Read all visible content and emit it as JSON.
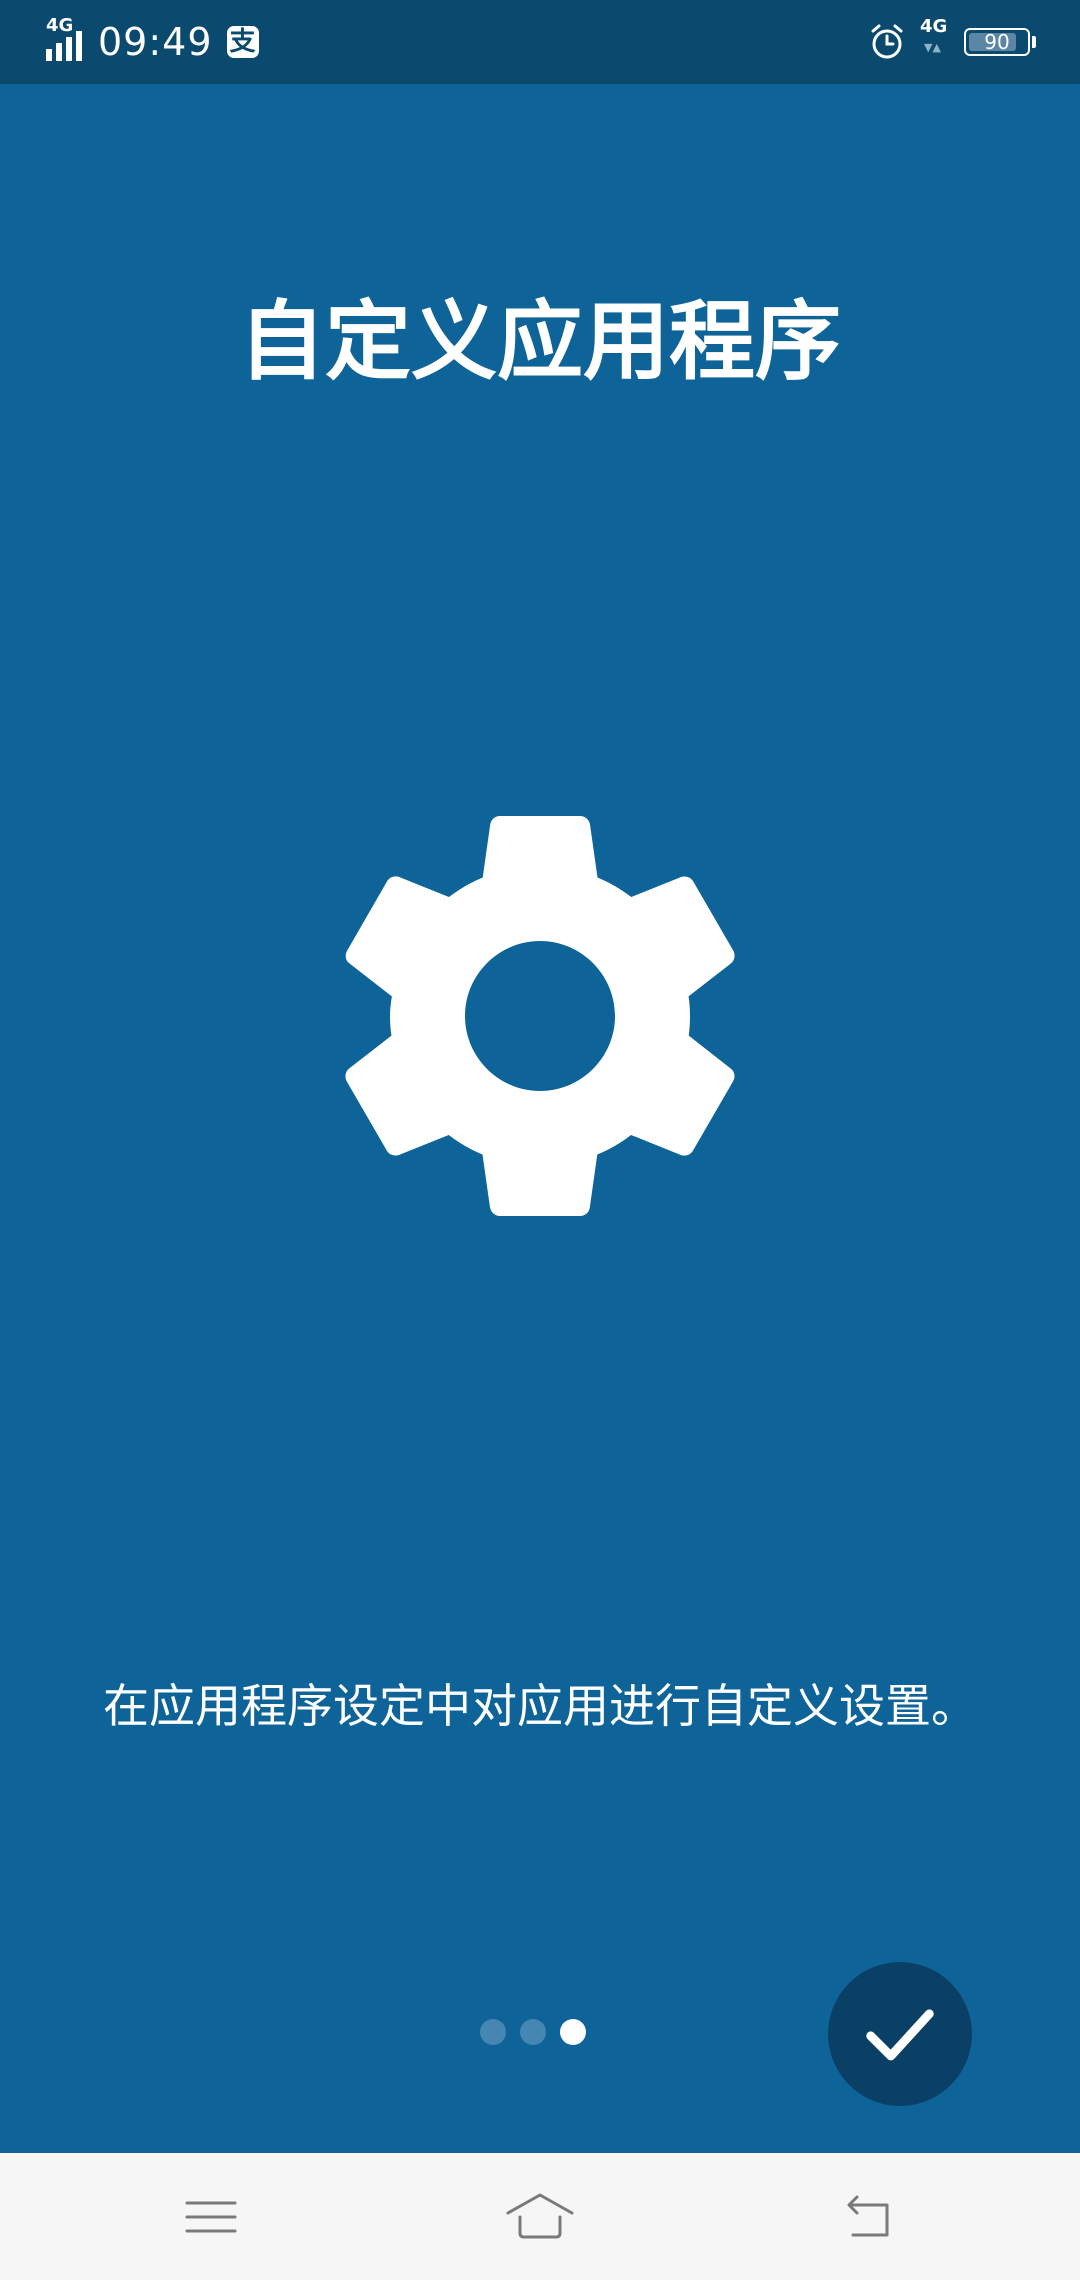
{
  "status_bar": {
    "network_left": "4G",
    "time": "09:49",
    "payment_icon": "alipay-icon",
    "alarm_icon": "alarm-clock-icon",
    "network_right": "4G",
    "battery_level": "90"
  },
  "onboarding": {
    "title": "自定义应用程序",
    "icon": "gear-icon",
    "description": "在应用程序设定中对应用进行自定义设置。",
    "page_count": 3,
    "current_page": 3
  },
  "actions": {
    "confirm_icon": "checkmark-icon"
  },
  "nav_bar": {
    "menu_icon": "menu-icon",
    "home_icon": "home-icon",
    "back_icon": "back-icon"
  },
  "colors": {
    "background": "#0e6499",
    "status_bar": "#0a4a6e",
    "fab": "#0a4066",
    "dot_inactive": "#4586b3",
    "nav_bar": "#f6f6f6"
  }
}
